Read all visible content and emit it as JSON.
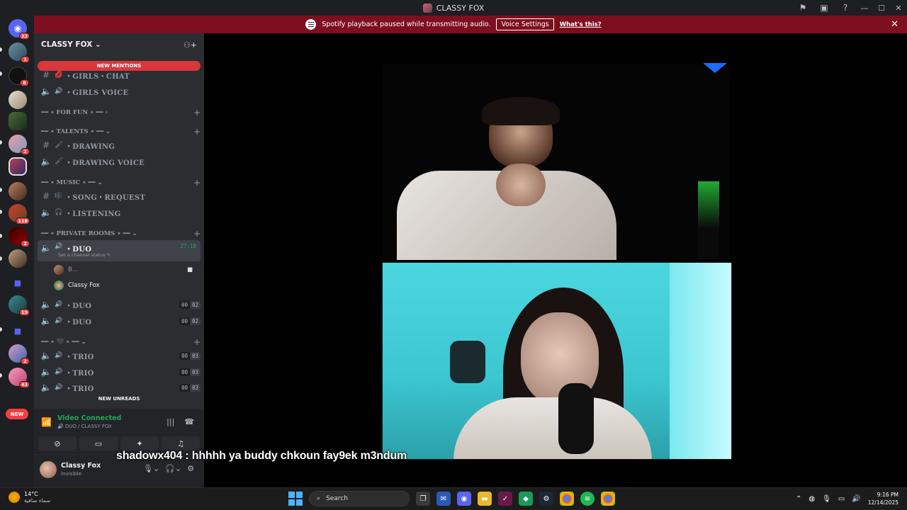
{
  "window": {
    "title": "CLASSY FOX"
  },
  "notice": {
    "text": "Spotify playback paused while transmitting audio.",
    "button": "Voice Settings",
    "link": "What's this?"
  },
  "rail": {
    "badges": [
      "33",
      "1",
      "8",
      "2",
      "118",
      "2",
      "19",
      "2",
      "43",
      "1"
    ],
    "new_label": "NEW"
  },
  "sidebar": {
    "server_name": "CLASSY FOX",
    "new_mentions": "NEW MENTIONS",
    "new_unreads": "NEW UNREADS",
    "channels": [
      {
        "type": "text",
        "emoji": "💋",
        "name": "・GIRLS・CHAT"
      },
      {
        "type": "voice",
        "emoji": "🔊",
        "name": "・GIRLS VOICE"
      },
      {
        "type": "category",
        "name": "━━ ⋆ FOR FUN ⋆ ━━ ›"
      },
      {
        "type": "category",
        "name": "━━ ⋆ TALENTS ⋆ ━━ ⌄"
      },
      {
        "type": "text",
        "emoji": "🖌",
        "name": "・DRAWING"
      },
      {
        "type": "voice",
        "emoji": "🖌",
        "name": "・DRAWING VOICE"
      },
      {
        "type": "category",
        "name": "━━ ⋆ MUSIC ⋆ ━━ ⌄"
      },
      {
        "type": "text",
        "emoji": "🎼",
        "name": "・SONG・REQUEST"
      },
      {
        "type": "voice",
        "emoji": "🎧",
        "name": "・LISTENING"
      },
      {
        "type": "category",
        "name": "━━ ⋆ PRIVATE ROOMS ⋆ ━━ ⌄"
      },
      {
        "type": "voice-active",
        "emoji": "🔊",
        "name": "・DUO",
        "timer": "27:18",
        "status": "Set a channel status"
      },
      {
        "type": "voice",
        "emoji": "🔊",
        "name": "・DUO",
        "count": [
          "00",
          "02"
        ]
      },
      {
        "type": "voice",
        "emoji": "🔊",
        "name": "・DUO",
        "count": [
          "00",
          "02"
        ]
      },
      {
        "type": "category",
        "name": "━━ ⋆ 🖤 ⋆ ━━ ⌄"
      },
      {
        "type": "voice",
        "emoji": "🔊",
        "name": "・TRIO",
        "count": [
          "00",
          "03"
        ]
      },
      {
        "type": "voice",
        "emoji": "🔊",
        "name": "・TRIO",
        "count": [
          "00",
          "03"
        ]
      },
      {
        "type": "voice",
        "emoji": "🔊",
        "name": "・TRIO",
        "count": [
          "00",
          "03"
        ]
      }
    ],
    "voice_users": [
      "B...",
      "Classy Fox"
    ]
  },
  "voice_panel": {
    "status": "Video Connected",
    "channel": "DUO / CLASSY FOX"
  },
  "user_panel": {
    "name": "Classy Fox",
    "status": "Invisible"
  },
  "stage": {
    "subtitle": "shadowx404 : hhhhh ya buddy chkoun fay9ek m3ndum"
  },
  "taskbar": {
    "temperature": "14°C",
    "weather": "سماء صافية",
    "search": "Search",
    "time": "9:16 PM",
    "date": "12/14/2025"
  },
  "colors": {
    "notice_bg": "#7d0f1e",
    "connected": "#23a55a",
    "badge": "#f23f43"
  }
}
